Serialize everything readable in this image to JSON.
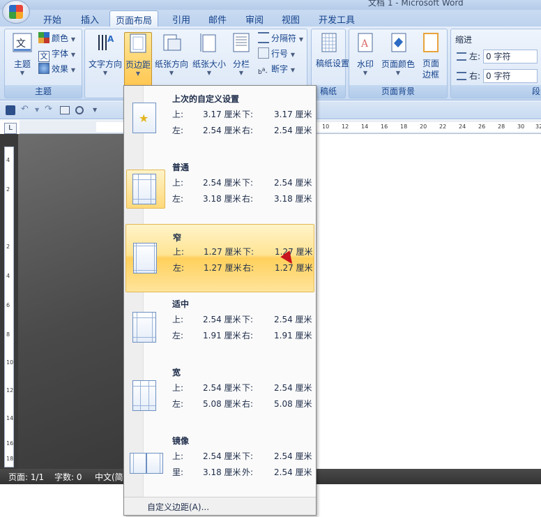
{
  "window": {
    "title": "文档 1 - Microsoft Word"
  },
  "tabs": [
    {
      "label": "开始"
    },
    {
      "label": "插入"
    },
    {
      "label": "页面布局",
      "active": true
    },
    {
      "label": "引用"
    },
    {
      "label": "邮件"
    },
    {
      "label": "审阅"
    },
    {
      "label": "视图"
    },
    {
      "label": "开发工具"
    }
  ],
  "ribbon": {
    "theme_group": {
      "label": "主题",
      "theme_button": "主题",
      "colors": "颜色",
      "fonts": "字体",
      "effects": "效果"
    },
    "page_setup_group": {
      "text_direction": "文字方向",
      "margins": "页边距",
      "orientation": "纸张方向",
      "size": "纸张大小",
      "columns": "分栏",
      "breaks": "分隔符",
      "line_numbers": "行号",
      "hyphenation": "断字"
    },
    "manuscript_group": {
      "label": "稿纸",
      "button": "稿纸设置"
    },
    "background_group": {
      "label": "页面背景",
      "watermark": "水印",
      "page_color": "页面颜色",
      "page_borders": "页面边框"
    },
    "paragraph_group": {
      "label": "段",
      "indent_title": "缩进",
      "left_label": "左:",
      "left_value": "0 字符",
      "right_label": "右:",
      "right_value": "0 字符"
    }
  },
  "ruler_ticks": [
    "10",
    "12",
    "14",
    "16",
    "18",
    "20",
    "22",
    "24",
    "26",
    "28",
    "30",
    "32"
  ],
  "vruler_ticks": [
    "4",
    "2",
    "2",
    "4",
    "6",
    "8",
    "10",
    "12",
    "14",
    "16",
    "18"
  ],
  "status": {
    "page": "页面: 1/1",
    "words": "字数: 0",
    "lang": "中文(简"
  },
  "margins_menu": {
    "items": [
      {
        "name": "上次的自定义设置",
        "l1": "上:",
        "v1": "3.17 厘米",
        "l2": "下:",
        "v2": "3.17 厘米",
        "l3": "左:",
        "v3": "2.54 厘米",
        "l4": "右:",
        "v4": "2.54 厘米"
      },
      {
        "name": "普通",
        "l1": "上:",
        "v1": "2.54 厘米",
        "l2": "下:",
        "v2": "2.54 厘米",
        "l3": "左:",
        "v3": "3.18 厘米",
        "l4": "右:",
        "v4": "3.18 厘米"
      },
      {
        "name": "窄",
        "l1": "上:",
        "v1": "1.27 厘米",
        "l2": "下:",
        "v2": "1.27 厘米",
        "l3": "左:",
        "v3": "1.27 厘米",
        "l4": "右:",
        "v4": "1.27 厘米"
      },
      {
        "name": "适中",
        "l1": "上:",
        "v1": "2.54 厘米",
        "l2": "下:",
        "v2": "2.54 厘米",
        "l3": "左:",
        "v3": "1.91 厘米",
        "l4": "右:",
        "v4": "1.91 厘米"
      },
      {
        "name": "宽",
        "l1": "上:",
        "v1": "2.54 厘米",
        "l2": "下:",
        "v2": "2.54 厘米",
        "l3": "左:",
        "v3": "5.08 厘米",
        "l4": "右:",
        "v4": "5.08 厘米"
      },
      {
        "name": "镜像",
        "l1": "上:",
        "v1": "2.54 厘米",
        "l2": "下:",
        "v2": "2.54 厘米",
        "l3": "里:",
        "v3": "3.18 厘米",
        "l4": "外:",
        "v4": "2.54 厘米"
      }
    ],
    "footer": "自定义边距(A)..."
  }
}
